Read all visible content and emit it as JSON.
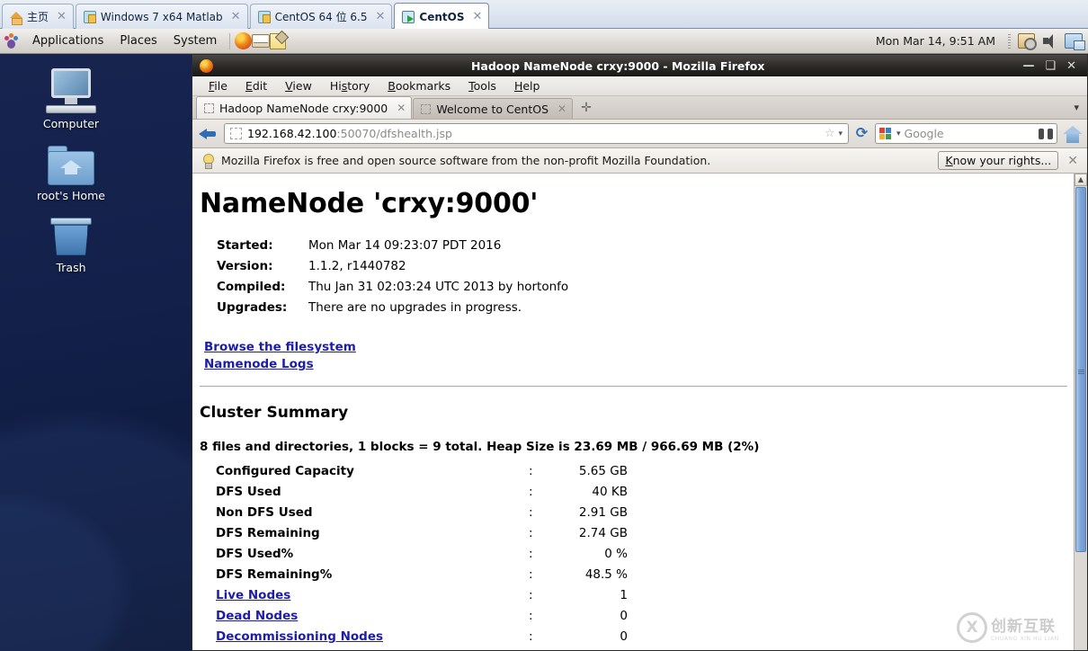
{
  "vm_tabbar": {
    "tabs": [
      {
        "label": "主页",
        "icon": "home-orange-icon",
        "active": false
      },
      {
        "label": "Windows 7 x64 Matlab",
        "icon": "vm-suspended-icon",
        "active": false
      },
      {
        "label": "CentOS 64 位 6.5",
        "icon": "vm-suspended-icon",
        "active": false
      },
      {
        "label": "CentOS",
        "icon": "vm-running-icon",
        "active": true
      }
    ],
    "close_glyph": "✕"
  },
  "gnome_panel": {
    "menus": [
      "Applications",
      "Places",
      "System"
    ],
    "launchers": [
      "firefox-icon",
      "evolution-mail-icon",
      "text-editor-icon"
    ],
    "clock": "Mon Mar 14,  9:51 AM",
    "tray": [
      "software-update-icon",
      "volume-icon",
      "display-icon"
    ]
  },
  "desktop": {
    "icons": [
      {
        "label": "Computer",
        "icon": "computer-icon"
      },
      {
        "label": "root's Home",
        "icon": "home-folder-icon"
      },
      {
        "label": "Trash",
        "icon": "trash-icon"
      }
    ]
  },
  "browser": {
    "window_title": "Hadoop NameNode crxy:9000 - Mozilla Firefox",
    "window_buttons": {
      "minimize": "—",
      "maximize": "❑",
      "close": "✕"
    },
    "menus": [
      {
        "pre": "",
        "acc": "F",
        "post": "ile"
      },
      {
        "pre": "",
        "acc": "E",
        "post": "dit"
      },
      {
        "pre": "",
        "acc": "V",
        "post": "iew"
      },
      {
        "pre": "Hi",
        "acc": "s",
        "post": "tory"
      },
      {
        "pre": "",
        "acc": "B",
        "post": "ookmarks"
      },
      {
        "pre": "",
        "acc": "T",
        "post": "ools"
      },
      {
        "pre": "",
        "acc": "H",
        "post": "elp"
      }
    ],
    "tabs": [
      {
        "label": "Hadoop NameNode crxy:9000",
        "active": true
      },
      {
        "label": "Welcome to CentOS",
        "active": false
      }
    ],
    "new_tab_glyph": "✛",
    "tab_list_glyph": "▾",
    "tab_close_glyph": "✕",
    "url": {
      "host": "192.168.42.100",
      "path": ":50070/dfshealth.jsp"
    },
    "url_star_glyph": "☆",
    "url_chevron_glyph": "▾",
    "search": {
      "engine": "google-icon",
      "placeholder": "Google",
      "chevron": "▾"
    },
    "notification": {
      "text": "Mozilla Firefox is free and open source software from the non-profit Mozilla Foundation.",
      "button_pre": "",
      "button_acc": "K",
      "button_post": "now your rights...",
      "close_glyph": "✕"
    }
  },
  "page": {
    "title": "NameNode 'crxy:9000'",
    "meta": [
      {
        "key": "Started:",
        "value": "Mon Mar 14 09:23:07 PDT 2016"
      },
      {
        "key": "Version:",
        "value": "1.1.2, r1440782"
      },
      {
        "key": "Compiled:",
        "value": "Thu Jan 31 02:03:24 UTC 2013 by hortonfo"
      },
      {
        "key": "Upgrades:",
        "value": "There are no upgrades in progress."
      }
    ],
    "links": [
      "Browse the filesystem",
      "Namenode Logs"
    ],
    "section_title": "Cluster Summary",
    "summary": "8 files and directories, 1 blocks = 9 total. Heap Size is 23.69 MB / 966.69 MB (2%)",
    "stats": [
      {
        "label": "Configured Capacity",
        "sep": ":",
        "value": "5.65 GB",
        "link": false
      },
      {
        "label": "DFS Used",
        "sep": ":",
        "value": "40 KB",
        "link": false
      },
      {
        "label": "Non DFS Used",
        "sep": ":",
        "value": "2.91 GB",
        "link": false
      },
      {
        "label": "DFS Remaining",
        "sep": ":",
        "value": "2.74 GB",
        "link": false
      },
      {
        "label": "DFS Used%",
        "sep": ":",
        "value": "0 %",
        "link": false
      },
      {
        "label": "DFS Remaining%",
        "sep": ":",
        "value": "48.5 %",
        "link": false
      },
      {
        "label": "Live Nodes",
        "sep": ":",
        "value": "1",
        "link": true
      },
      {
        "label": "Dead Nodes",
        "sep": ":",
        "value": "0",
        "link": true
      },
      {
        "label": "Decommissioning Nodes",
        "sep": ":",
        "value": "0",
        "link": true
      }
    ]
  },
  "watermark": {
    "cn": "创新互联",
    "en": "CHUANG XIN HU LIAN"
  },
  "colors": {
    "link": "#1d1da8",
    "scrollbar": "#7ea7d8",
    "desktop": "#12204a"
  }
}
